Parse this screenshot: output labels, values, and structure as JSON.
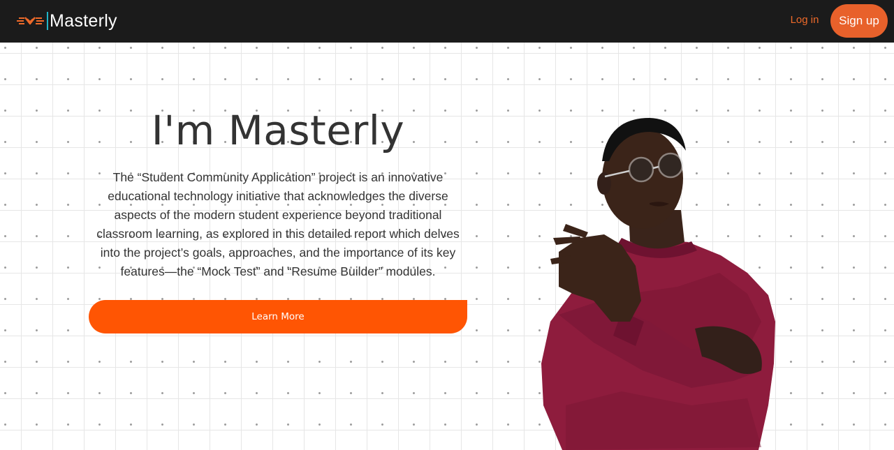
{
  "navbar": {
    "brand_name": "Masterly",
    "login_label": "Log in",
    "signup_label": "Sign up"
  },
  "hero": {
    "title": "I'm Masterly",
    "description": "The “Student Community Application” project is an innovative educational technology initiative that acknowledges the diverse aspects of the modern student experience beyond traditional classroom learning, as explored in this detailed report which delves into the project’s goals, approaches, and the importance of its key features—the “Mock Test” and “Resume Builder” modules.",
    "cta_label": "Learn More",
    "image": "person-crossed-arms-photo"
  },
  "icons": {
    "brand_logo": "masterly-logo-icon"
  },
  "colors": {
    "navbar_bg": "#1b1b1b",
    "accent_orange": "#ff5503",
    "signup_bg": "#e8612b",
    "brand_divider": "#1fb6c9",
    "text_dark": "#333333",
    "sweater": "#8e1c3d"
  }
}
